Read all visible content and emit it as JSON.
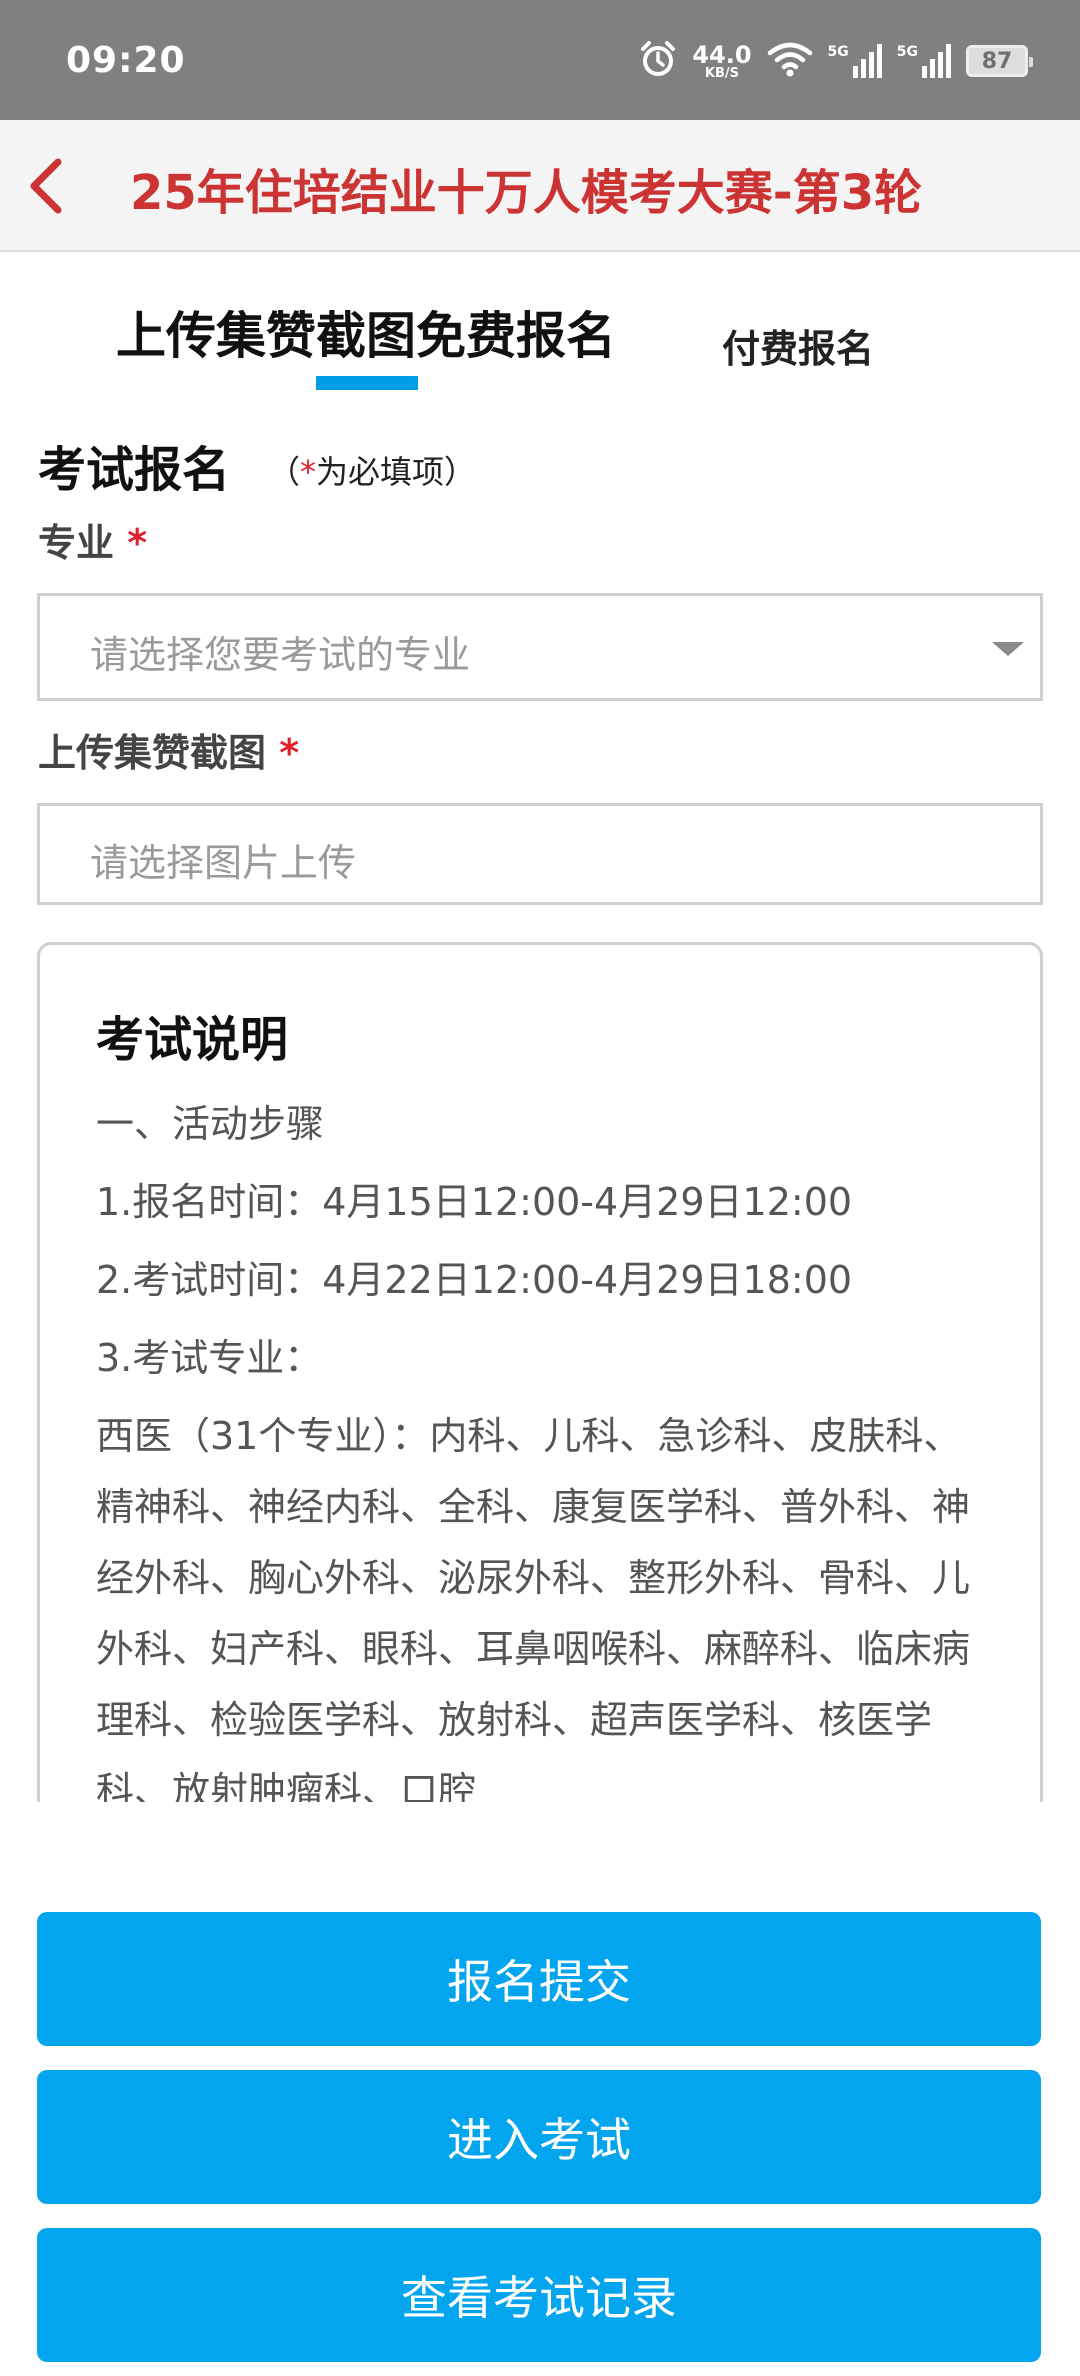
{
  "status_bar": {
    "time": "09:20",
    "net_speed_value": "44.0",
    "net_speed_unit": "KB/S",
    "signal1_label": "5G",
    "signal2_label": "5G",
    "battery": "87",
    "icons": [
      "alarm-icon",
      "wifi-icon",
      "signal-icon",
      "signal-icon",
      "battery-icon"
    ]
  },
  "header": {
    "title": "25年住培结业十万人模考大赛-第3轮",
    "back_icon": "chevron-left-icon",
    "accent_color": "#cc3333"
  },
  "tabs": [
    {
      "label": "上传集赞截图免费报名",
      "active": true
    },
    {
      "label": "付费报名",
      "active": false
    }
  ],
  "form": {
    "title": "考试报名",
    "required_note_open": "（",
    "required_note_star": "*",
    "required_note_text": "为必填项）",
    "major_label": "专业",
    "major_placeholder": "请选择您要考试的专业",
    "upload_label": "上传集赞截图",
    "upload_placeholder": "请选择图片上传",
    "required_star": "*"
  },
  "exam_info": {
    "title": "考试说明",
    "step_heading": "一、活动步骤",
    "signup_time": "1.报名时间：4月15日12:00-4月29日12:00",
    "exam_time": "2.考试时间：4月22日12:00-4月29日18:00",
    "majors_heading": "3.考试专业：",
    "majors_text": "西医（31个专业）：内科、儿科、急诊科、皮肤科、精神科、神经内科、全科、康复医学科、普外科、神经外科、胸心外科、泌尿外科、整形外科、骨科、儿外科、妇产科、眼科、耳鼻咽喉科、麻醉科、临床病理科、检验医学科、放射科、超声医学科、核医学科、放射肿瘤科、口腔"
  },
  "buttons": {
    "submit": "报名提交",
    "enter_exam": "进入考试",
    "view_records": "查看考试记录",
    "color": "#03a5ee"
  }
}
